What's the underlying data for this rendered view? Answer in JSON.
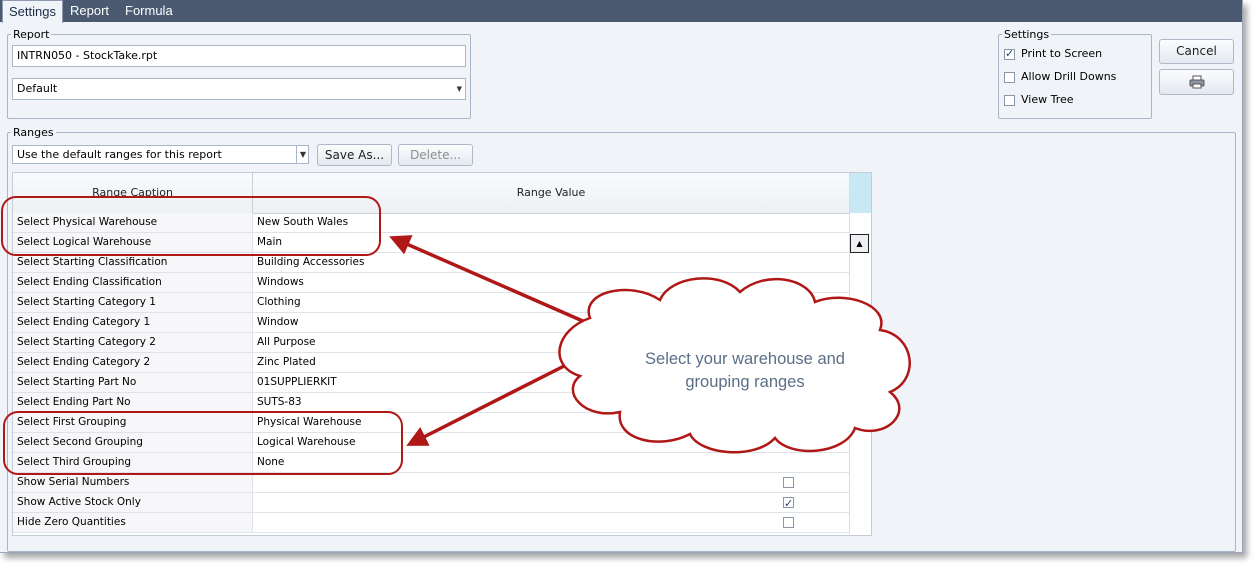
{
  "tabs": [
    "Settings",
    "Report",
    "Formula"
  ],
  "report_group": {
    "legend": "Report",
    "report_name": "INTRN050 - StockTake.rpt",
    "layout_selection": "Default"
  },
  "settings_group": {
    "legend": "Settings",
    "options": [
      {
        "label": "Print to Screen",
        "checked": true
      },
      {
        "label": "Allow Drill Downs",
        "checked": false
      },
      {
        "label": "View Tree",
        "checked": false
      }
    ]
  },
  "buttons": {
    "cancel": "Cancel",
    "print_icon": "printer-icon",
    "save_as": "Save As...",
    "delete": "Delete..."
  },
  "ranges_group": {
    "legend": "Ranges",
    "preset": "Use the default ranges for this report"
  },
  "grid": {
    "columns": [
      "Range Caption",
      "Range Value"
    ],
    "rows": [
      {
        "caption": "Select Physical Warehouse",
        "value": "New South Wales"
      },
      {
        "caption": "Select Logical Warehouse",
        "value": "Main"
      },
      {
        "caption": "Select Starting Classification",
        "value": "Building Accessories"
      },
      {
        "caption": "Select Ending Classification",
        "value": "Windows"
      },
      {
        "caption": "Select Starting Category 1",
        "value": "Clothing"
      },
      {
        "caption": "Select Ending Category 1",
        "value": "Window"
      },
      {
        "caption": "Select Starting Category 2",
        "value": "All Purpose"
      },
      {
        "caption": "Select Ending Category 2",
        "value": "Zinc Plated"
      },
      {
        "caption": "Select Starting Part No",
        "value": "01SUPPLIERKIT"
      },
      {
        "caption": "Select Ending Part No",
        "value": "SUTS-83"
      },
      {
        "caption": "Select First Grouping",
        "value": "Physical Warehouse"
      },
      {
        "caption": "Select Second Grouping",
        "value": "Logical Warehouse"
      },
      {
        "caption": "Select Third Grouping",
        "value": "None"
      },
      {
        "caption": "Show Serial Numbers",
        "checkbox": true,
        "checked": false
      },
      {
        "caption": "Show Active Stock Only",
        "checkbox": true,
        "checked": true
      },
      {
        "caption": "Hide Zero Quantities",
        "checkbox": true,
        "checked": false
      }
    ]
  },
  "callout": {
    "text_line1": "Select your warehouse and",
    "text_line2": "grouping ranges"
  },
  "colors": {
    "tabbar": "#4b5a70",
    "annotation_red": "#b01818",
    "callout_text": "#5a6e86"
  }
}
